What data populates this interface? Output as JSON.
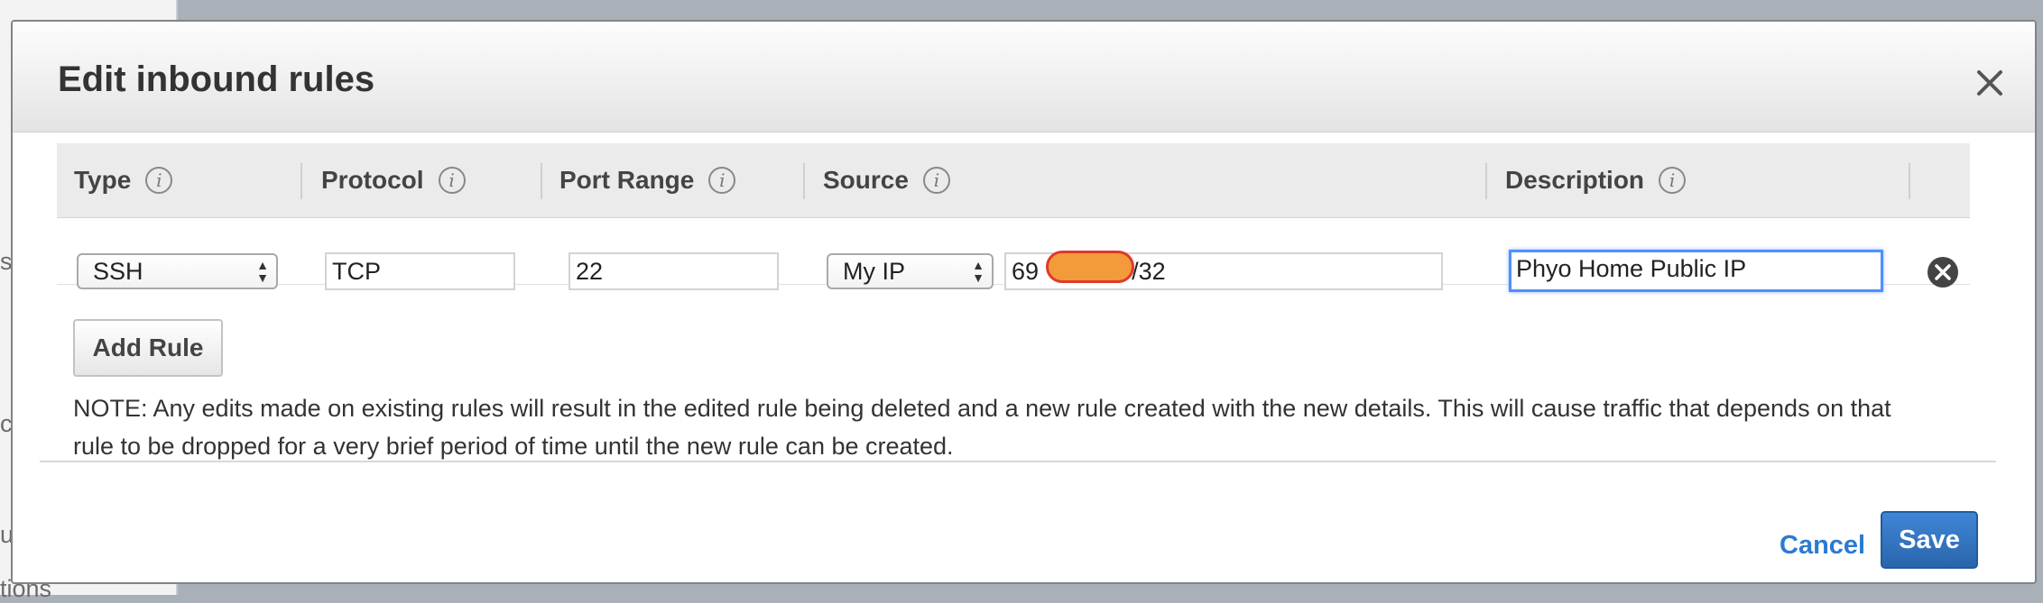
{
  "modal": {
    "title": "Edit inbound rules"
  },
  "columns": [
    {
      "label": "Type",
      "info_icon": "info-icon"
    },
    {
      "label": "Protocol",
      "info_icon": "info-icon"
    },
    {
      "label": "Port Range",
      "info_icon": "info-icon"
    },
    {
      "label": "Source",
      "info_icon": "info-icon"
    },
    {
      "label": "Description",
      "info_icon": "info-icon"
    }
  ],
  "rule": {
    "type": "SSH",
    "protocol": "TCP",
    "port_range": "22",
    "source_type": "My IP",
    "source_prefix": "69",
    "source_suffix": "3/32",
    "description": "Phyo Home Public IP"
  },
  "buttons": {
    "add_rule": "Add Rule",
    "cancel": "Cancel",
    "save": "Save"
  },
  "note": "NOTE: Any edits made on existing rules will result in the edited rule being deleted and a new rule created with the new details. This will cause traffic that depends on that rule to be dropped for a very brief period of time until the new rule can be created.",
  "colors": {
    "primary_button": "#2a65ad",
    "link": "#2b7bd1",
    "focus": "#4d90fe",
    "redaction": "#f39a3a"
  }
}
